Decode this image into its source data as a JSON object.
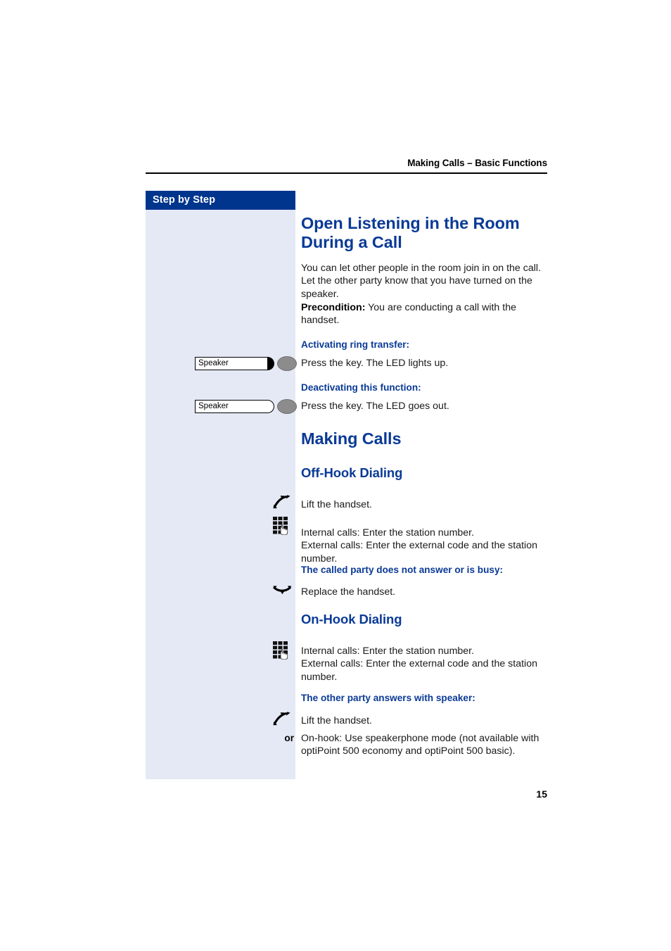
{
  "page": {
    "running_header": "Making Calls – Basic Functions",
    "folio": "15"
  },
  "sidebar": {
    "title": "Step by Step"
  },
  "sections": [
    {
      "id": "open-listening",
      "heading": "Open Listening in the Room During a Call",
      "intro": "You can let other people in the room join in on the call. Let the other party know that you have turned on the speaker.",
      "precondition_label": "Precondition:",
      "precondition_text": " You are conducting a call with the handset.",
      "steps": [
        {
          "minor_heading": "Activating ring transfer:",
          "key_label": "Speaker",
          "led_state": "on",
          "text": "Press the key. The LED lights up."
        },
        {
          "minor_heading": "Deactivating this function:",
          "key_label": "Speaker",
          "led_state": "off",
          "text": "Press the key. The LED goes out."
        }
      ]
    },
    {
      "id": "making-calls",
      "heading": "Making Calls",
      "subsections": [
        {
          "id": "off-hook",
          "heading": "Off-Hook Dialing",
          "items": [
            {
              "icon": "handset-lift-icon",
              "text": "Lift the handset."
            },
            {
              "icon": "keypad-icon",
              "text": "Internal calls: Enter the station number.\nExternal calls: Enter the external code and the station number."
            }
          ],
          "minor_heading": "The called party does not answer or is busy:",
          "after_items": [
            {
              "icon": "handset-replace-icon",
              "text": "Replace the handset."
            }
          ]
        },
        {
          "id": "on-hook",
          "heading": "On-Hook Dialing",
          "items": [
            {
              "icon": "keypad-icon",
              "text": "Internal calls: Enter the station number.\nExternal calls: Enter the external code and the station number."
            }
          ],
          "minor_heading": "The other party answers with speaker:",
          "after_items": [
            {
              "icon": "handset-lift-icon",
              "text": "Lift the handset."
            },
            {
              "icon": "or-label",
              "or_label": "or",
              "text": "On-hook: Use speakerphone mode (not available with optiPoint 500 economy and optiPoint 500 basic)."
            }
          ]
        }
      ]
    }
  ],
  "colors": {
    "sidebar_header_blue": "#00358e",
    "sidebar_body_blue": "#e5e9f5",
    "heading_blue": "#0a3a96",
    "key_led_on": "#000000",
    "key_oval_gray": "#8c8c8c"
  }
}
